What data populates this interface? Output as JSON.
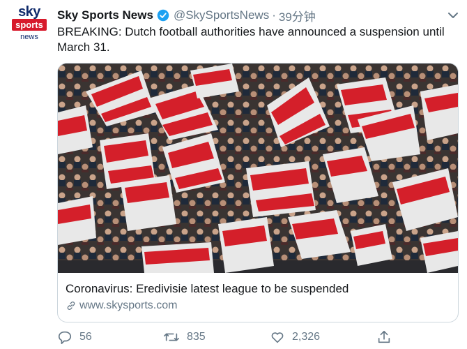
{
  "account": {
    "avatar_top": "sky",
    "avatar_mid": "sports",
    "avatar_bottom": "news",
    "name": "Sky Sports News",
    "handle": "@SkySportsNews",
    "separator": "·",
    "time": "39分钟"
  },
  "tweet": {
    "text": "BREAKING: Dutch football authorities have announced a suspension until March 31."
  },
  "card": {
    "image_alt": "Crowd of fans waving red and white flags in stadium",
    "title": "Coronavirus: Eredivisie latest league to be suspended",
    "url": "www.skysports.com"
  },
  "actions": {
    "replies": "56",
    "retweets": "835",
    "likes": "2,326"
  },
  "colors": {
    "verified": "#1da1f2",
    "muted": "#657786",
    "brand_red": "#d7192b",
    "brand_navy": "#0f2a6b"
  }
}
